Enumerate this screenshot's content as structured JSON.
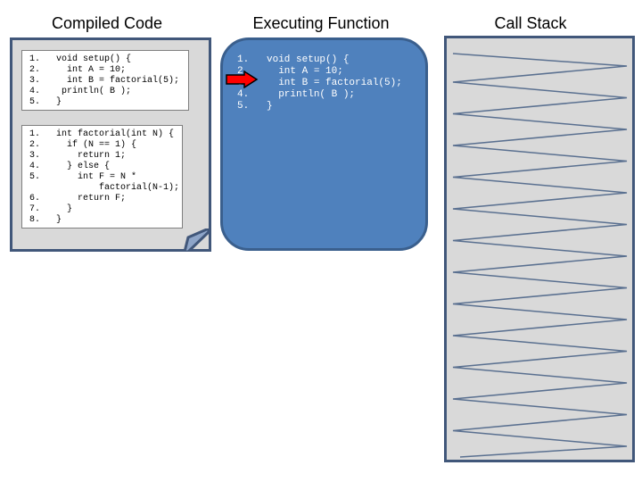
{
  "headers": {
    "compiled": "Compiled Code",
    "executing": "Executing Function",
    "stack": "Call Stack"
  },
  "compiled": {
    "setup": "1.   void setup() {\n2.     int A = 10;\n3.     int B = factorial(5);\n4.    println( B );\n5.   }",
    "factorial": "1.   int factorial(int N) {\n2.     if (N == 1) {\n3.       return 1;\n4.     } else {\n5.       int F = N *\n             factorial(N-1);\n6.       return F;\n7.     }\n8.   }"
  },
  "executing": {
    "code": "1.   void setup() {\n2.     int A = 10;\n3.     int B = factorial(5);\n4.     println( B );\n5.   }",
    "current_line": 3
  },
  "colors": {
    "doc_border": "#41577a",
    "exec_fill": "#4f81bd",
    "arrow": "#ff0000",
    "spring": "#5a7090"
  }
}
